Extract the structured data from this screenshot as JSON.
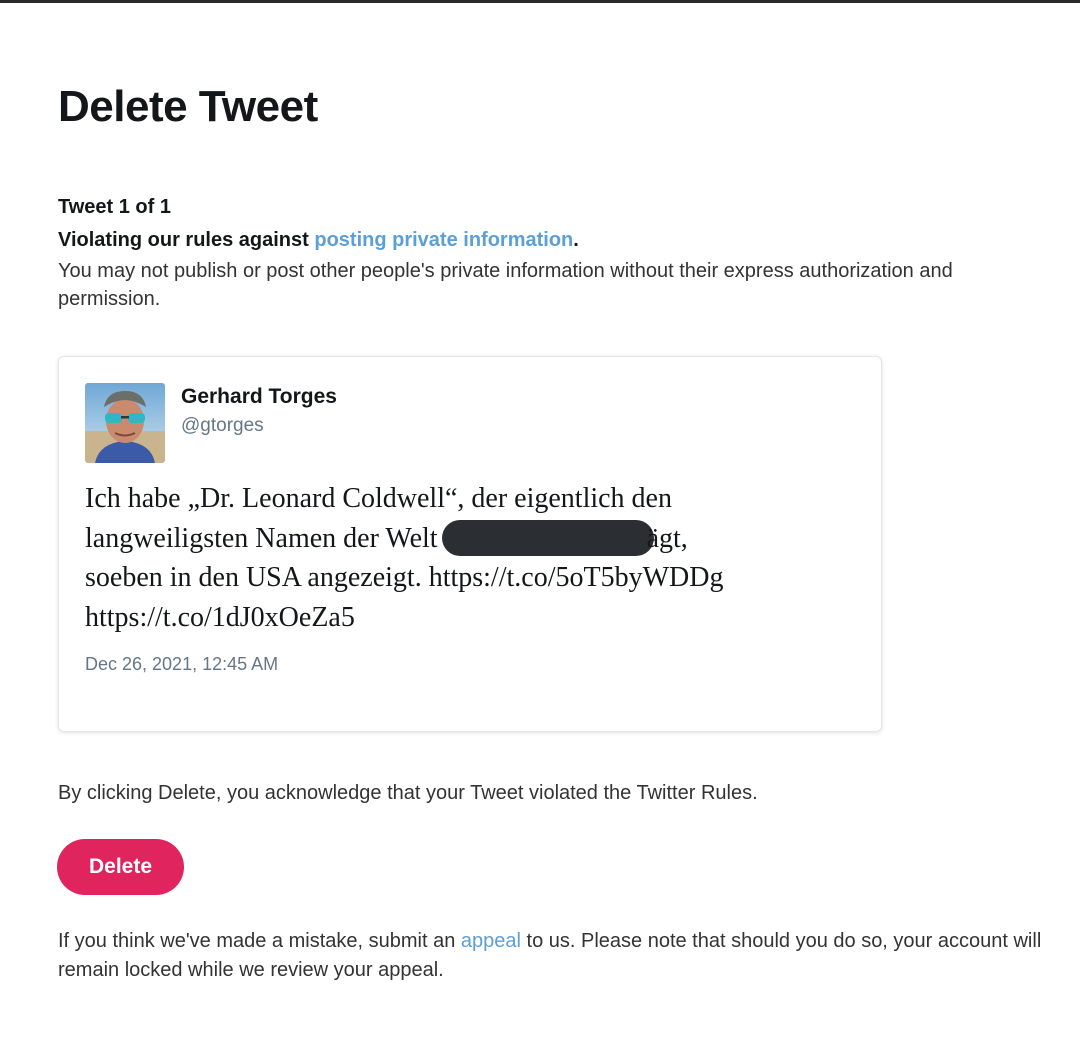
{
  "page": {
    "title": "Delete Tweet"
  },
  "violation": {
    "tweet_count": "Tweet 1 of 1",
    "rule_prefix": "Violating our rules against ",
    "rule_link": "posting private information",
    "rule_suffix": ".",
    "description": "You may not publish or post other people's private information without their express authorization and permission."
  },
  "tweet": {
    "author_name": "Gerhard Torges",
    "author_handle": "@gtorges",
    "text_line1": "Ich habe „Dr. Leonard Coldwell“, der eigentlich den",
    "text_line2_before": "langweiligsten Namen der Welt",
    "text_line2_after": "ägt,",
    "text_line3": "soeben in den USA angezeigt. https://t.co/5oT5byWDDg",
    "text_line4": "https://t.co/1dJ0xOeZa5",
    "timestamp": "Dec 26, 2021, 12:45 AM"
  },
  "acknowledgement": "By clicking Delete, you acknowledge that your Tweet violated the Twitter Rules.",
  "actions": {
    "delete_label": "Delete"
  },
  "appeal": {
    "prefix": "If you think we've made a mistake, submit an ",
    "link": "appeal",
    "suffix": " to us. Please note that should you do so, your account will remain locked while we review your appeal."
  },
  "colors": {
    "link": "#5b9fd8",
    "delete_button": "#e0245e",
    "redaction": "#2b2f33",
    "muted_text": "#657786"
  },
  "icons": {
    "avatar": "user-avatar-photo"
  }
}
